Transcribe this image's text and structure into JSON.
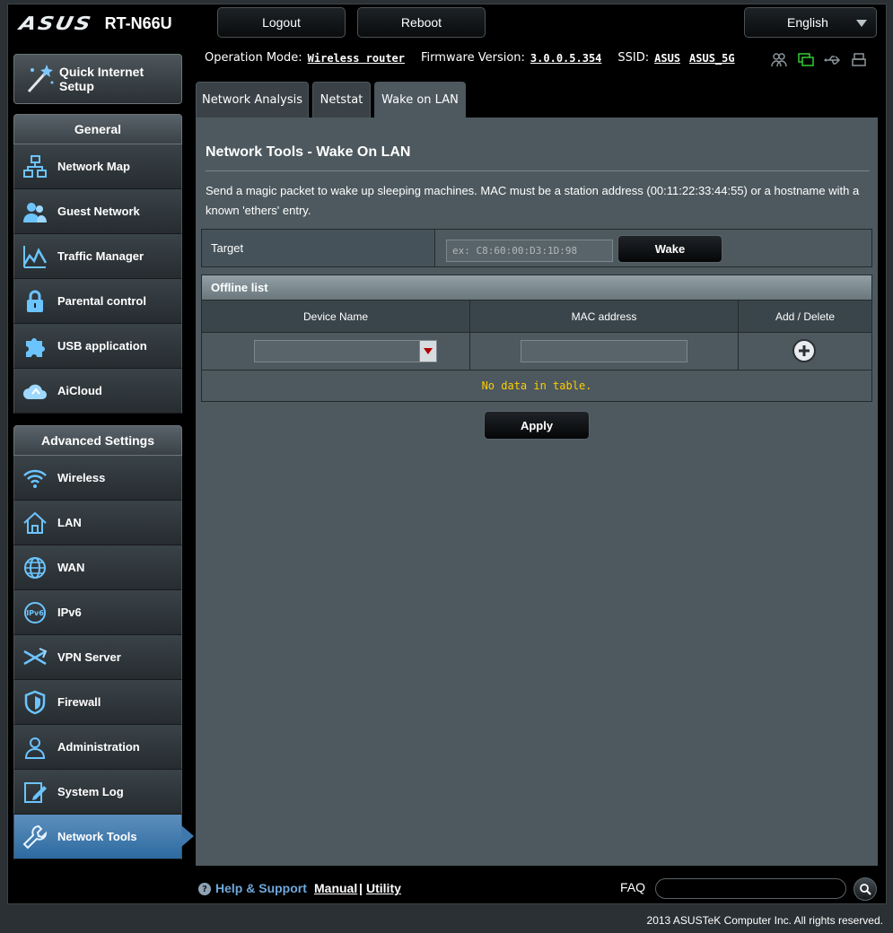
{
  "header": {
    "brand": "ASUS",
    "model": "RT-N66U",
    "logout_label": "Logout",
    "reboot_label": "Reboot",
    "language": "English"
  },
  "status": {
    "operation_mode_label": "Operation Mode:",
    "operation_mode_value": "Wireless router",
    "firmware_label": "Firmware Version:",
    "firmware_value": "3.0.0.5.354",
    "ssid_label": "SSID:",
    "ssid_values": [
      "ASUS",
      "ASUS_5G"
    ],
    "icons": [
      "clients-icon",
      "network-status-icon",
      "usb-icon",
      "printer-icon"
    ]
  },
  "sidebar": {
    "quick_setup_label": "Quick Internet Setup",
    "general_title": "General",
    "general_items": [
      {
        "label": "Network Map",
        "icon": "network-map-icon"
      },
      {
        "label": "Guest Network",
        "icon": "guest-network-icon"
      },
      {
        "label": "Traffic Manager",
        "icon": "traffic-manager-icon"
      },
      {
        "label": "Parental control",
        "icon": "lock-icon"
      },
      {
        "label": "USB application",
        "icon": "puzzle-icon"
      },
      {
        "label": "AiCloud",
        "icon": "cloud-icon"
      }
    ],
    "advanced_title": "Advanced Settings",
    "advanced_items": [
      {
        "label": "Wireless",
        "icon": "wifi-icon"
      },
      {
        "label": "LAN",
        "icon": "home-icon"
      },
      {
        "label": "WAN",
        "icon": "globe-icon"
      },
      {
        "label": "IPv6",
        "icon": "ipv6-icon"
      },
      {
        "label": "VPN Server",
        "icon": "vpn-icon"
      },
      {
        "label": "Firewall",
        "icon": "shield-icon"
      },
      {
        "label": "Administration",
        "icon": "user-icon"
      },
      {
        "label": "System Log",
        "icon": "log-icon"
      },
      {
        "label": "Network Tools",
        "icon": "wrench-icon",
        "active": true
      }
    ]
  },
  "tabs": [
    {
      "label": "Network Analysis"
    },
    {
      "label": "Netstat"
    },
    {
      "label": "Wake on LAN",
      "active": true
    }
  ],
  "main": {
    "title": "Network Tools - Wake On LAN",
    "description": "Send a magic packet to wake up sleeping machines. MAC must be a station address (00:11:22:33:44:55) or a hostname with a known 'ethers' entry.",
    "target_label": "Target",
    "target_placeholder": "ex: C8:60:00:D3:1D:98",
    "wake_label": "Wake",
    "offline_title": "Offline list",
    "columns": [
      "Device Name",
      "MAC address",
      "Add / Delete"
    ],
    "empty_text": "No data in table.",
    "apply_label": "Apply"
  },
  "footer": {
    "help_label": "Help & Support",
    "manual_label": "Manual",
    "separator": "|",
    "utility_label": "Utility",
    "faq_label": "FAQ",
    "copyright": "2013 ASUSTeK Computer Inc. All rights reserved."
  },
  "colors": {
    "accent_blue": "#3f78ad",
    "panel": "#4d595f",
    "empty_text": "#ffcc00",
    "status_active": "#33cc33"
  }
}
